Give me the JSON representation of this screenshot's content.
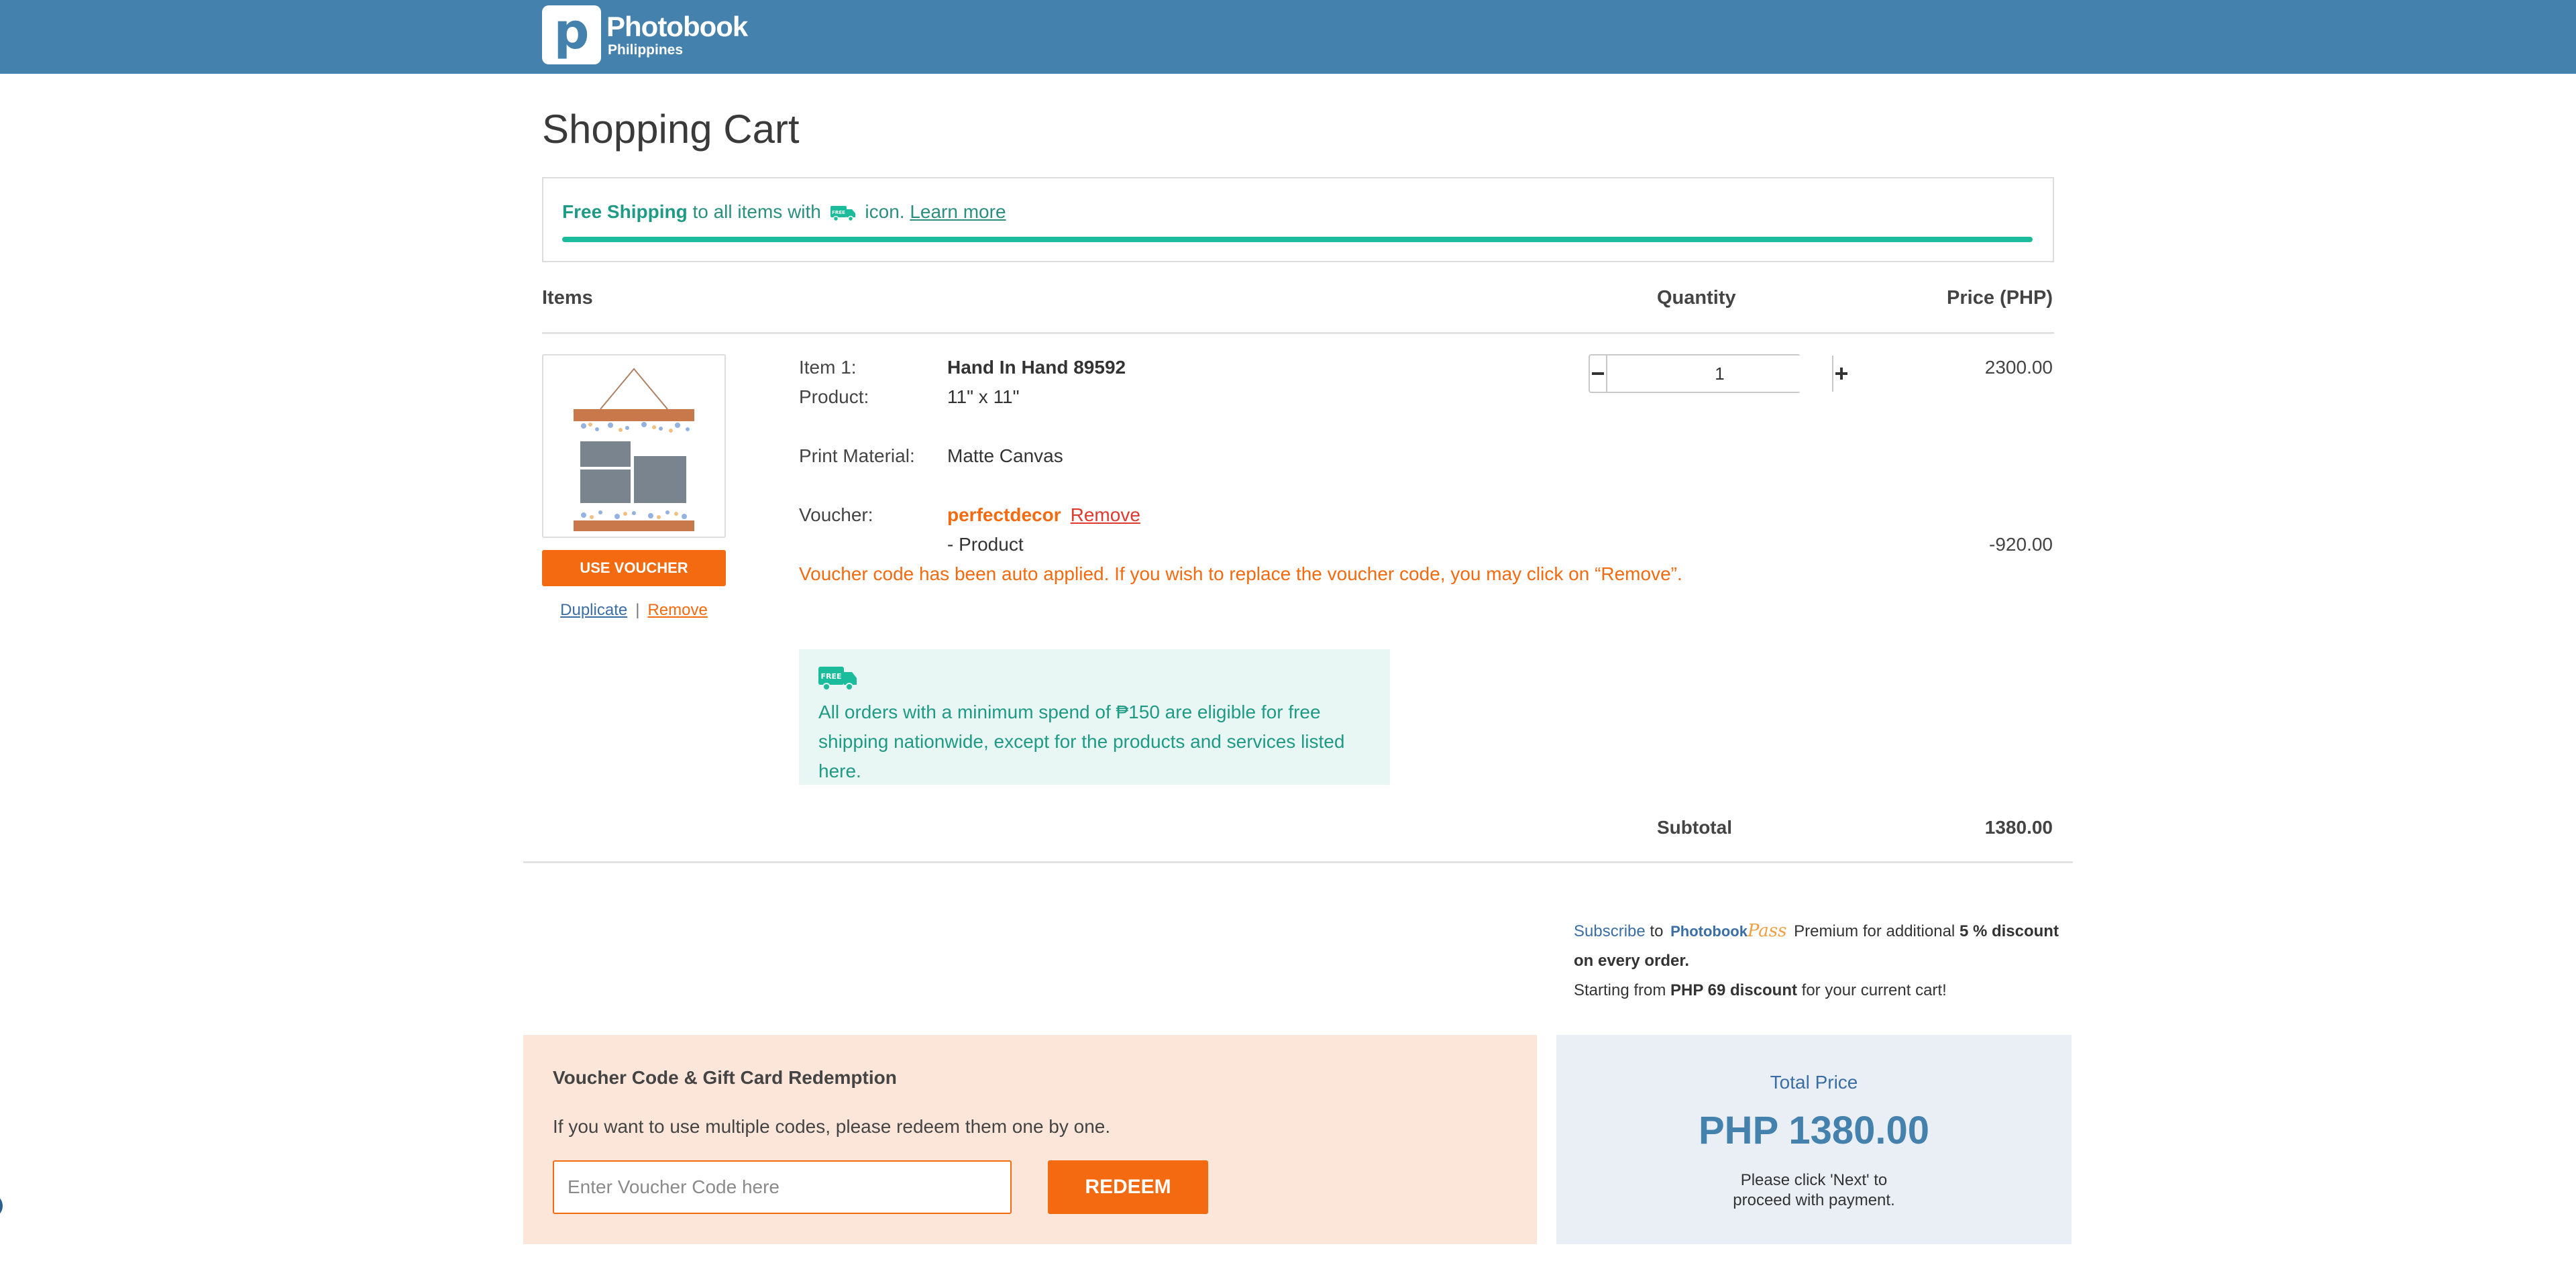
{
  "header": {
    "brand": "Photobook",
    "region": "Philippines",
    "logo_letter": "p"
  },
  "page": {
    "title": "Shopping Cart"
  },
  "shipping_banner": {
    "strong": "Free Shipping",
    "text_before_icon": " to all items with ",
    "text_after_icon": " icon. ",
    "link": "Learn more",
    "icon": "free-shipping-truck-icon"
  },
  "columns": {
    "items": "Items",
    "quantity": "Quantity",
    "price": "Price (PHP)"
  },
  "item": {
    "index_label": "Item 1:",
    "name": "Hand In Hand 89592",
    "product_label": "Product:",
    "product_value": "11\" x 11\"",
    "material_label": "Print Material:",
    "material_value": "Matte Canvas",
    "voucher_label": "Voucher:",
    "voucher_code": "perfectdecor",
    "voucher_remove": "Remove",
    "voucher_scope": "- Product",
    "voucher_message": "Voucher code has been auto applied. If you wish to replace the voucher code, you may click on “Remove”.",
    "quantity": "1",
    "price": "2300.00",
    "discount": "-920.00",
    "use_voucher_label": "USE VOUCHER",
    "duplicate_label": "Duplicate",
    "separator": "|",
    "remove_label": "Remove"
  },
  "info_box": {
    "icon": "free-shipping-truck-icon",
    "text": "All orders with a minimum spend of ₱150 are eligible for free shipping nationwide, except for the products and services listed here."
  },
  "subtotal": {
    "label": "Subtotal",
    "value": "1380.00"
  },
  "subscribe": {
    "link": "Subscribe",
    "to": " to ",
    "brand": "Photobook",
    "brand_script": "Pass",
    "text1": " Premium for additional ",
    "pct": "5 % discount on every order.",
    "text2": "Starting from ",
    "discount": "PHP 69 discount",
    "text3": " for your current cart!"
  },
  "redemption": {
    "title": "Voucher Code & Gift Card Redemption",
    "subtitle": "If you want to use multiple codes, please redeem them one by one.",
    "placeholder": "Enter Voucher Code here",
    "button": "REDEEM"
  },
  "total": {
    "label": "Total Price",
    "value": "PHP 1380.00",
    "note": "Please click 'Next' to proceed with payment."
  },
  "colors": {
    "brand_blue": "#4581ad",
    "accent_orange": "#f36a10",
    "teal": "#1bbc9b"
  }
}
